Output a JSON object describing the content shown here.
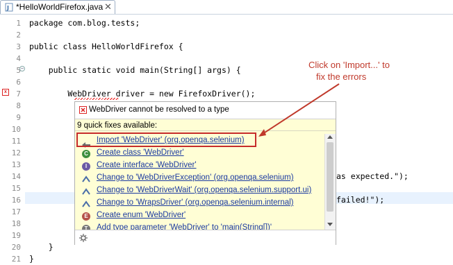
{
  "tab": {
    "label": "*HelloWorldFirefox.java",
    "close": "✕",
    "icon": "java-file-icon"
  },
  "editor": {
    "line_numbers": [
      "1",
      "2",
      "3",
      "4",
      "5",
      "6",
      "7",
      "8",
      "9",
      "10",
      "11",
      "12",
      "13",
      "14",
      "15",
      "16",
      "17",
      "18",
      "19",
      "20",
      "21"
    ],
    "code": {
      "l1": "package com.blog.tests;",
      "l3": "public class HelloWorldFirefox {",
      "l5": "    public static void main(String[] args) {",
      "l7": "        WebDriver driver = new FirefoxDriver();",
      "l14_tail": "as expected.\");",
      "l16_tail": "failed!\");",
      "l20": "    }",
      "l21": "}"
    }
  },
  "popup": {
    "header": "WebDriver cannot be resolved to a type",
    "count": "9 quick fixes available:",
    "items": [
      {
        "label": "Import 'WebDriver' (org.openqa.selenium)",
        "icon": "import-icon"
      },
      {
        "label": "Create class 'WebDriver'",
        "icon": "class-icon"
      },
      {
        "label": "Create interface 'WebDriver'",
        "icon": "interface-icon"
      },
      {
        "label": "Change to 'WebDriverException' (org.openqa.selenium)",
        "icon": "change-icon"
      },
      {
        "label": "Change to 'WebDriverWait' (org.openqa.selenium.support.ui)",
        "icon": "change-icon"
      },
      {
        "label": "Change to 'WrapsDriver' (org.openqa.selenium.internal)",
        "icon": "change-icon"
      },
      {
        "label": "Create enum 'WebDriver'",
        "icon": "enum-icon"
      },
      {
        "label": "Add type parameter 'WebDriver' to 'main(String[])'",
        "icon": "type-param-icon"
      }
    ]
  },
  "annotation": {
    "line1": "Click on 'Import...' to",
    "line2": "fix the errors"
  },
  "colors": {
    "annotation": "#c0392b",
    "link": "#1b3aa0",
    "popup_bg": "#fffed5",
    "current_line": "#e8f2fe"
  }
}
